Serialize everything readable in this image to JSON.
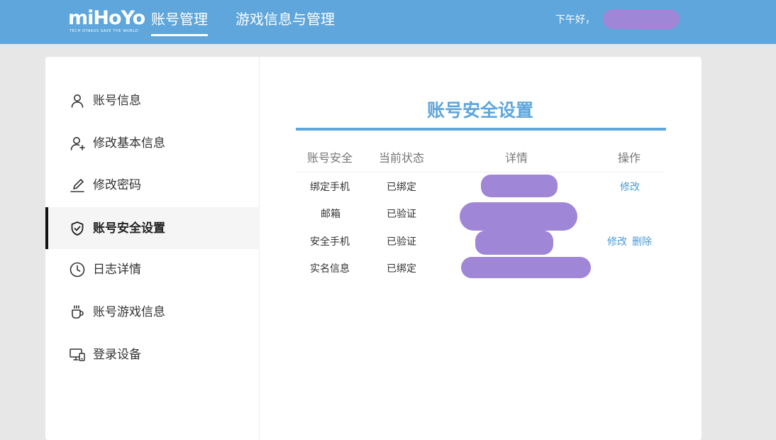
{
  "header": {
    "logo_text": "miHoYo",
    "logo_tagline": "TECH OTAKUS SAVE THE WORLD",
    "tabs": [
      {
        "label": "账号管理",
        "active": true
      },
      {
        "label": "游戏信息与管理",
        "active": false
      }
    ],
    "greeting": "下午好，"
  },
  "sidebar": {
    "items": [
      {
        "label": "账号信息",
        "icon": "user-icon",
        "active": false
      },
      {
        "label": "修改基本信息",
        "icon": "user-plus-icon",
        "active": false
      },
      {
        "label": "修改密码",
        "icon": "pencil-icon",
        "active": false
      },
      {
        "label": "账号安全设置",
        "icon": "shield-check-icon",
        "active": true
      },
      {
        "label": "日志详情",
        "icon": "clock-icon",
        "active": false
      },
      {
        "label": "账号游戏信息",
        "icon": "cup-icon",
        "active": false
      },
      {
        "label": "登录设备",
        "icon": "devices-icon",
        "active": false
      }
    ]
  },
  "main": {
    "title": "账号安全设置",
    "columns": [
      "账号安全",
      "当前状态",
      "详情",
      "操作"
    ],
    "rows": [
      {
        "item": "绑定手机",
        "status": "已绑定",
        "actions": [
          "修改"
        ]
      },
      {
        "item": "邮箱",
        "status": "已验证",
        "actions": []
      },
      {
        "item": "安全手机",
        "status": "已验证",
        "actions": [
          "修改",
          "删除"
        ]
      },
      {
        "item": "实名信息",
        "status": "已绑定",
        "actions": []
      }
    ]
  },
  "colors": {
    "accent": "#5ea6db",
    "link": "#4a9ad6",
    "redaction": "#a086d6"
  }
}
